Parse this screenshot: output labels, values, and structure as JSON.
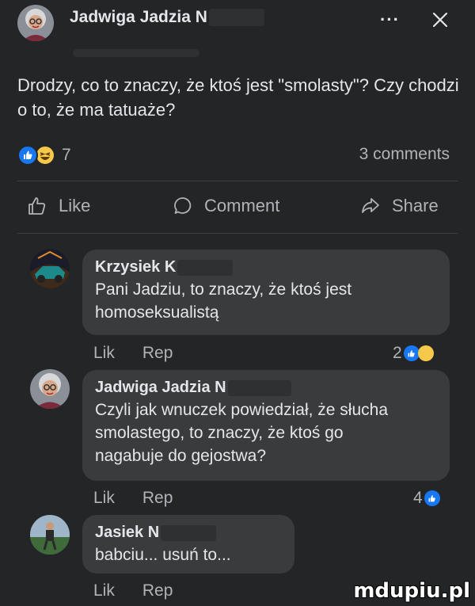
{
  "post": {
    "author": "Jadwiga Jadzia N",
    "text": "Drodzy, co to znaczy, że ktoś jest \"smolasty\"? Czy chodzi o to, że ma tatuaże?",
    "reaction_count": "7",
    "comments_count": "3 comments",
    "header_icons": [
      "more-icon",
      "close-icon"
    ],
    "more_label": "···"
  },
  "actions": {
    "like": "Like",
    "comment": "Comment",
    "share": "Share"
  },
  "comments": [
    {
      "author": "Krzysiek K",
      "text": "Pani Jadziu, to znaczy, że ktoś jest homoseksualistą",
      "like_label": "Lik",
      "reply_label": "Rep",
      "reaction_count": "2"
    },
    {
      "author": "Jadwiga Jadzia N",
      "text": "Czyli jak wnuczek powiedział, że słucha smolastego, to znaczy, że ktoś go nagabuje do gejostwa?",
      "like_label": "Lik",
      "reply_label": "Rep",
      "reaction_count": "4"
    },
    {
      "author": "Jasiek N",
      "text": "babciu... usuń to...",
      "like_label": "Lik",
      "reply_label": "Rep",
      "reaction_count": ""
    }
  ],
  "watermark": "mdupiu.pl",
  "colors": {
    "background": "#242526",
    "bubble": "#3a3b3c",
    "like_blue": "#1877f2",
    "haha_yellow": "#f7c94a",
    "muted_text": "#b0b3b8"
  }
}
